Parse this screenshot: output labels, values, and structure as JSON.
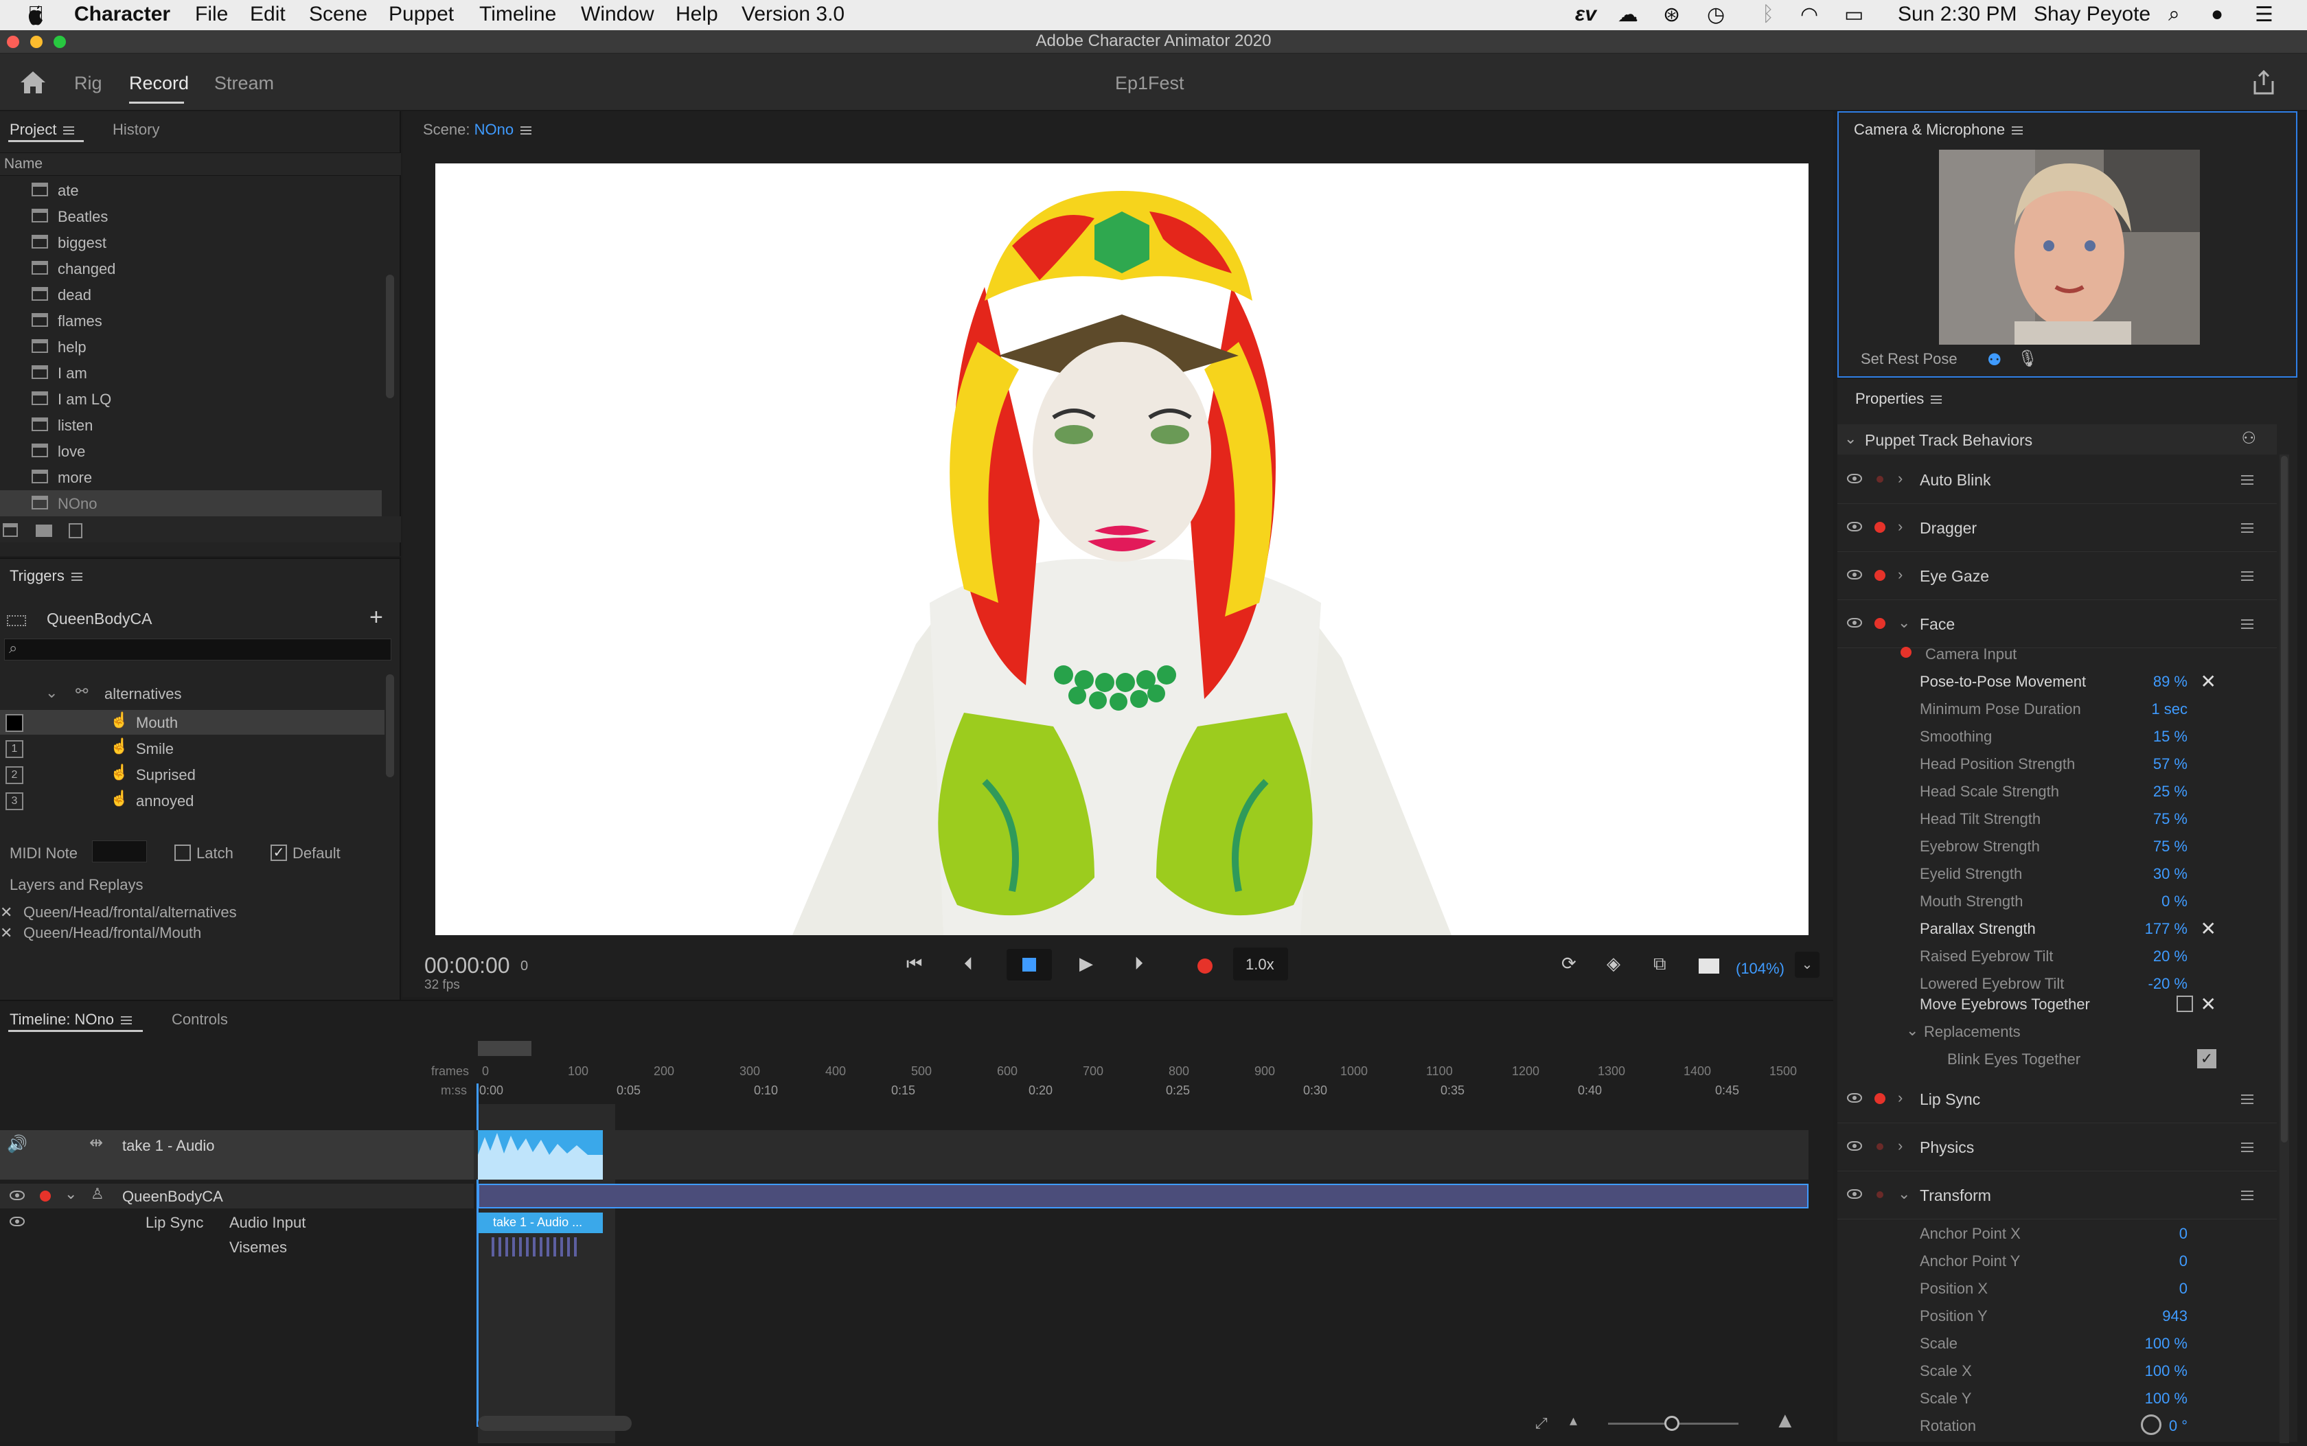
{
  "menubar": {
    "app_name": "Character",
    "items": [
      "File",
      "Edit",
      "Scene",
      "Puppet",
      "Timeline",
      "Window",
      "Help",
      "Version 3.0"
    ],
    "clock": "Sun 2:30 PM",
    "user": "Shay Peyote"
  },
  "titlebar": {
    "title": "Adobe Character Animator 2020"
  },
  "header": {
    "tabs": [
      "Rig",
      "Record",
      "Stream"
    ],
    "active_tab": "Record",
    "document_name": "Ep1Fest"
  },
  "project": {
    "tab_project": "Project",
    "tab_history": "History",
    "column_name": "Name",
    "items": [
      "ate",
      "Beatles",
      "biggest",
      "changed",
      "dead",
      "flames",
      "help",
      "I am",
      "I am LQ",
      "listen",
      "love",
      "more",
      "NOno"
    ],
    "selected": "NOno"
  },
  "triggers": {
    "title": "Triggers",
    "puppet": "QueenBodyCA",
    "group": "alternatives",
    "items": [
      {
        "key": "",
        "label": "Mouth"
      },
      {
        "key": "1",
        "label": "Smile"
      },
      {
        "key": "2",
        "label": "Suprised"
      },
      {
        "key": "3",
        "label": "annoyed"
      }
    ],
    "midi_label": "MIDI Note",
    "latch_label": "Latch",
    "default_label": "Default",
    "latch_checked": false,
    "default_checked": true,
    "layers_title": "Layers and Replays",
    "layers": [
      "Queen/Head/frontal/alternatives",
      "Queen/Head/frontal/Mouth"
    ]
  },
  "scene": {
    "label": "Scene:",
    "name": "NOno",
    "timecode": "00:00:00",
    "frame": "0",
    "fps": "32 fps",
    "speed": "1.0x",
    "zoom": "(104%)"
  },
  "camera": {
    "title": "Camera & Microphone",
    "set_rest_pose": "Set Rest Pose"
  },
  "properties": {
    "title": "Properties",
    "section": "Puppet Track Behaviors",
    "behaviors_top": [
      {
        "name": "Auto Blink",
        "armed": false
      },
      {
        "name": "Dragger",
        "armed": true
      },
      {
        "name": "Eye Gaze",
        "armed": true
      },
      {
        "name": "Face",
        "armed": true
      }
    ],
    "camera_input": "Camera Input",
    "face_params": [
      {
        "label": "Pose-to-Pose Movement",
        "value": "89 %",
        "highlight": true,
        "x": true
      },
      {
        "label": "Minimum Pose Duration",
        "value": "1 sec"
      },
      {
        "label": "Smoothing",
        "value": "15 %"
      },
      {
        "label": "Head Position Strength",
        "value": "57 %"
      },
      {
        "label": "Head Scale Strength",
        "value": "25 %"
      },
      {
        "label": "Head Tilt Strength",
        "value": "75 %"
      },
      {
        "label": "Eyebrow Strength",
        "value": "75 %"
      },
      {
        "label": "Eyelid Strength",
        "value": "30 %"
      },
      {
        "label": "Mouth Strength",
        "value": "0 %"
      },
      {
        "label": "Parallax Strength",
        "value": "177 %",
        "highlight": true,
        "x": true
      },
      {
        "label": "Raised Eyebrow Tilt",
        "value": "20 %"
      },
      {
        "label": "Lowered Eyebrow Tilt",
        "value": "-20 %"
      }
    ],
    "move_eyebrows": "Move Eyebrows Together",
    "replacements": "Replacements",
    "blink_eyes": "Blink Eyes Together",
    "behaviors_bottom": [
      {
        "name": "Lip Sync",
        "armed": true
      },
      {
        "name": "Physics",
        "armed": false
      },
      {
        "name": "Transform",
        "armed": false
      }
    ],
    "transform_params": [
      {
        "label": "Anchor Point X",
        "value": "0"
      },
      {
        "label": "Anchor Point Y",
        "value": "0"
      },
      {
        "label": "Position X",
        "value": "0"
      },
      {
        "label": "Position Y",
        "value": "943"
      },
      {
        "label": "Scale",
        "value": "100 %"
      },
      {
        "label": "Scale X",
        "value": "100 %"
      },
      {
        "label": "Scale Y",
        "value": "100 %"
      },
      {
        "label": "Rotation",
        "value": "0 °"
      }
    ]
  },
  "timeline": {
    "tab": "Timeline: NOno",
    "controls_tab": "Controls",
    "frames_label": "frames",
    "mss_label": "m:ss",
    "frame_ticks": [
      "0",
      "100",
      "200",
      "300",
      "400",
      "500",
      "600",
      "700",
      "800",
      "900",
      "1000",
      "1100",
      "1200",
      "1300",
      "1400",
      "1500"
    ],
    "time_ticks": [
      "0:00",
      "0:05",
      "0:10",
      "0:15",
      "0:20",
      "0:25",
      "0:30",
      "0:35",
      "0:40",
      "0:45"
    ],
    "audio_track": "take 1 - Audio",
    "puppet_track": "QueenBodyCA",
    "lip_sync": "Lip Sync",
    "audio_input": "Audio Input",
    "visemes": "Visemes",
    "clip_label": "take 1 - Audio ..."
  }
}
